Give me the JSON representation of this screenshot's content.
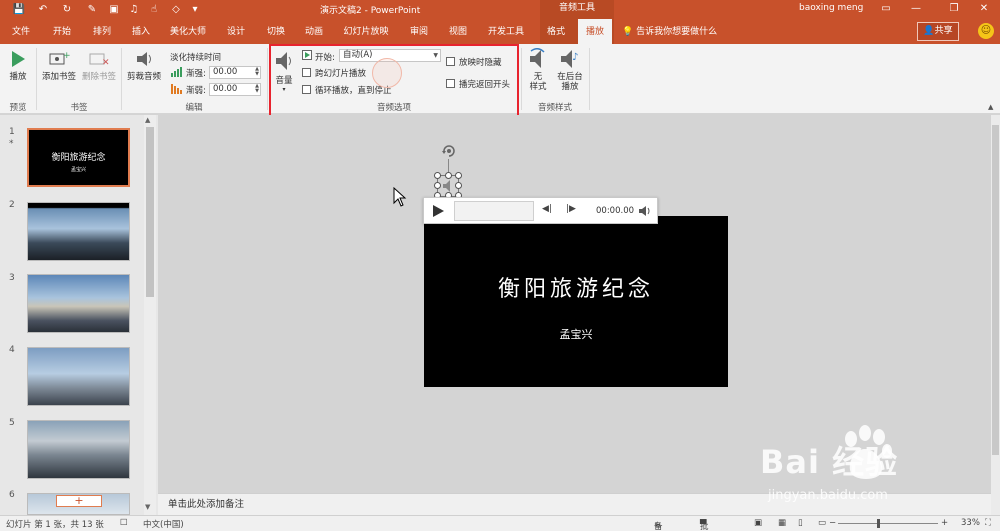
{
  "titlebar": {
    "doc_title": "演示文稿2 - PowerPoint",
    "tools_label": "音频工具",
    "user": "baoxing meng"
  },
  "tabs": [
    {
      "label": "文件"
    },
    {
      "label": "开始"
    },
    {
      "label": "排列"
    },
    {
      "label": "插入"
    },
    {
      "label": "美化大师"
    },
    {
      "label": "设计"
    },
    {
      "label": "切换"
    },
    {
      "label": "动画"
    },
    {
      "label": "幻灯片放映"
    },
    {
      "label": "审阅"
    },
    {
      "label": "视图"
    },
    {
      "label": "开发工具"
    },
    {
      "label": "格式"
    },
    {
      "label": "播放"
    }
  ],
  "tell_me": "告诉我你想要做什么",
  "share": "共享",
  "ribbon": {
    "play": "播放",
    "add_bookmark": "添加书签",
    "remove_bookmark": "删除书签",
    "trim_audio": "剪裁音频",
    "fade_duration": "淡化持续时间",
    "fade_in_label": "渐强:",
    "fade_in_value": "00.00",
    "fade_out_label": "渐弱:",
    "fade_out_value": "00.00",
    "volume": "音量",
    "start_label": "开始:",
    "start_value": "自动(A)",
    "play_across": "跨幻灯片播放",
    "loop": "循环播放，直到停止",
    "hide_during": "放映时隐藏",
    "rewind": "播完返回开头",
    "no_style": "无\n样式",
    "no_style_l1": "无",
    "no_style_l2": "样式",
    "bg_play_l1": "在后台",
    "bg_play_l2": "播放",
    "groups": {
      "preview": "预览",
      "bookmarks": "书签",
      "editing": "编辑",
      "audio_options": "音频选项",
      "audio_styles": "音频样式"
    }
  },
  "slides": [
    {
      "num": "1",
      "star": "*"
    },
    {
      "num": "2"
    },
    {
      "num": "3"
    },
    {
      "num": "4"
    },
    {
      "num": "5"
    },
    {
      "num": "6"
    }
  ],
  "thumb1": {
    "title": "衡阳旅游纪念",
    "sub": "孟宝兴"
  },
  "slide": {
    "title": "衡阳旅游纪念",
    "subtitle": "孟宝兴"
  },
  "player": {
    "time": "00:00.00"
  },
  "notes_placeholder": "单击此处添加备注",
  "status": {
    "slide_info": "幻灯片 第 1 张，共 13 张",
    "language": "中文(中国)",
    "notes": "备注",
    "comments": "批注",
    "zoom": "33%"
  },
  "watermark": {
    "brand": "Bai  经验",
    "url": "jingyan.baidu.com"
  },
  "colors": {
    "accent": "#c8512b",
    "highlight": "#e8232e"
  }
}
